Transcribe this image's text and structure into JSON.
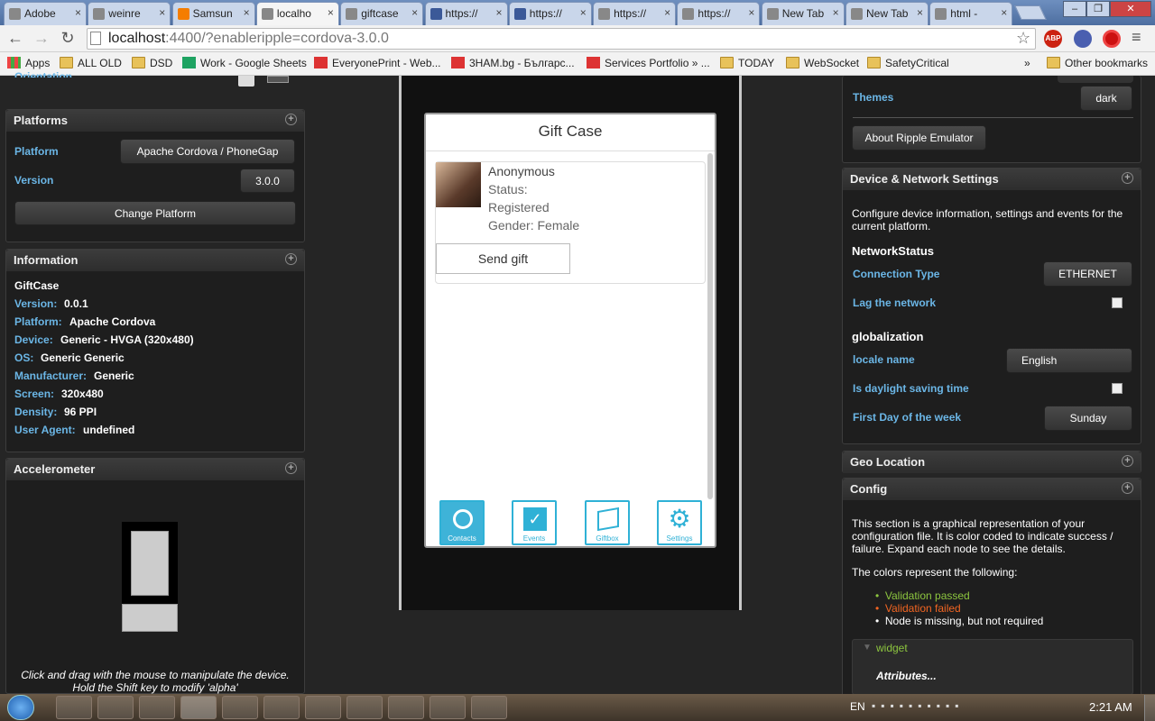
{
  "browser": {
    "tabs": [
      {
        "label": "Adobe",
        "icon": "adobe-icon"
      },
      {
        "label": "weinre",
        "icon": "weinre-icon"
      },
      {
        "label": "Samsun",
        "icon": "blogger-icon"
      },
      {
        "label": "localho",
        "icon": "page-icon",
        "active": true
      },
      {
        "label": "giftcase",
        "icon": "page-icon"
      },
      {
        "label": "https://",
        "icon": "facebook-icon"
      },
      {
        "label": "https://",
        "icon": "facebook-icon"
      },
      {
        "label": "https://",
        "icon": "page-icon"
      },
      {
        "label": "https://",
        "icon": "page-icon"
      },
      {
        "label": "New Tab",
        "icon": "page-icon"
      },
      {
        "label": "New Tab",
        "icon": "page-icon"
      },
      {
        "label": "html - ",
        "icon": "stackoverflow-icon"
      }
    ],
    "url_host": "localhost",
    "url_rest": ":4400/?enableripple=cordova-3.0.0",
    "bookmarks": [
      "Apps",
      "ALL OLD",
      "DSD",
      "Work - Google Sheets",
      "EveryonePrint - Web...",
      "3HAM.bg - Българс...",
      "Services Portfolio » ...",
      "TODAY",
      "WebSocket",
      "SafetyCritical"
    ],
    "bookmarks_more": "»",
    "other_bookmarks": "Other bookmarks"
  },
  "left": {
    "orientation_label": "Orientation",
    "platforms": {
      "title": "Platforms",
      "platform_label": "Platform",
      "platform_value": "Apache Cordova / PhoneGap",
      "version_label": "Version",
      "version_value": "3.0.0",
      "change_button": "Change Platform"
    },
    "information": {
      "title": "Information",
      "app_name": "GiftCase",
      "rows": [
        {
          "label": "Version:",
          "value": "0.0.1"
        },
        {
          "label": "Platform:",
          "value": "Apache Cordova"
        },
        {
          "label": "Device:",
          "value": "Generic - HVGA (320x480)"
        },
        {
          "label": "OS:",
          "value": "Generic Generic"
        },
        {
          "label": "Manufacturer:",
          "value": "Generic"
        },
        {
          "label": "Screen:",
          "value": "320x480"
        },
        {
          "label": "Density:",
          "value": "96 PPI"
        },
        {
          "label": "User Agent:",
          "value": "undefined"
        }
      ]
    },
    "accelerometer": {
      "title": "Accelerometer",
      "hint1": "Click and drag with the mouse to manipulate the device.",
      "hint2": "Hold the Shift key to modify 'alpha'"
    }
  },
  "app": {
    "title": "Gift Case",
    "contact": {
      "name": "Anonymous",
      "status_label": "Status:",
      "status_value": "Registered",
      "gender": "Gender: Female"
    },
    "send_gift": "Send gift",
    "tabs": [
      {
        "label": "Contacts",
        "icon": "contacts-icon",
        "active": true
      },
      {
        "label": "Events",
        "icon": "events-icon"
      },
      {
        "label": "Giftbox",
        "icon": "giftbox-icon"
      },
      {
        "label": "Settings",
        "icon": "settings-icon"
      }
    ]
  },
  "right": {
    "themes_label": "Themes",
    "themes_value": "dark",
    "about_button": "About Ripple Emulator",
    "device_network": {
      "title": "Device & Network Settings",
      "description": "Configure device information, settings and events for the current platform.",
      "network_heading": "NetworkStatus",
      "connection_label": "Connection Type",
      "connection_value": "ETHERNET",
      "lag_label": "Lag the network",
      "glob_heading": "globalization",
      "locale_label": "locale name",
      "locale_value": "English",
      "dst_label": "Is daylight saving time",
      "first_day_label": "First Day of the week",
      "first_day_value": "Sunday"
    },
    "geo_title": "Geo Location",
    "config": {
      "title": "Config",
      "description": "This section is a graphical representation of your configuration file. It is color coded to indicate success / failure. Expand each node to see the details.",
      "colors_intro": "The colors represent the following:",
      "legend": [
        {
          "text": "Validation passed",
          "color": "#8dc63f"
        },
        {
          "text": "Validation failed",
          "color": "#f26522"
        },
        {
          "text": "Node is missing, but not required",
          "color": "#ffffff"
        }
      ],
      "widget_label": "widget",
      "attributes_label": "Attributes..."
    }
  },
  "taskbar": {
    "language": "EN",
    "time": "2:21 AM"
  }
}
